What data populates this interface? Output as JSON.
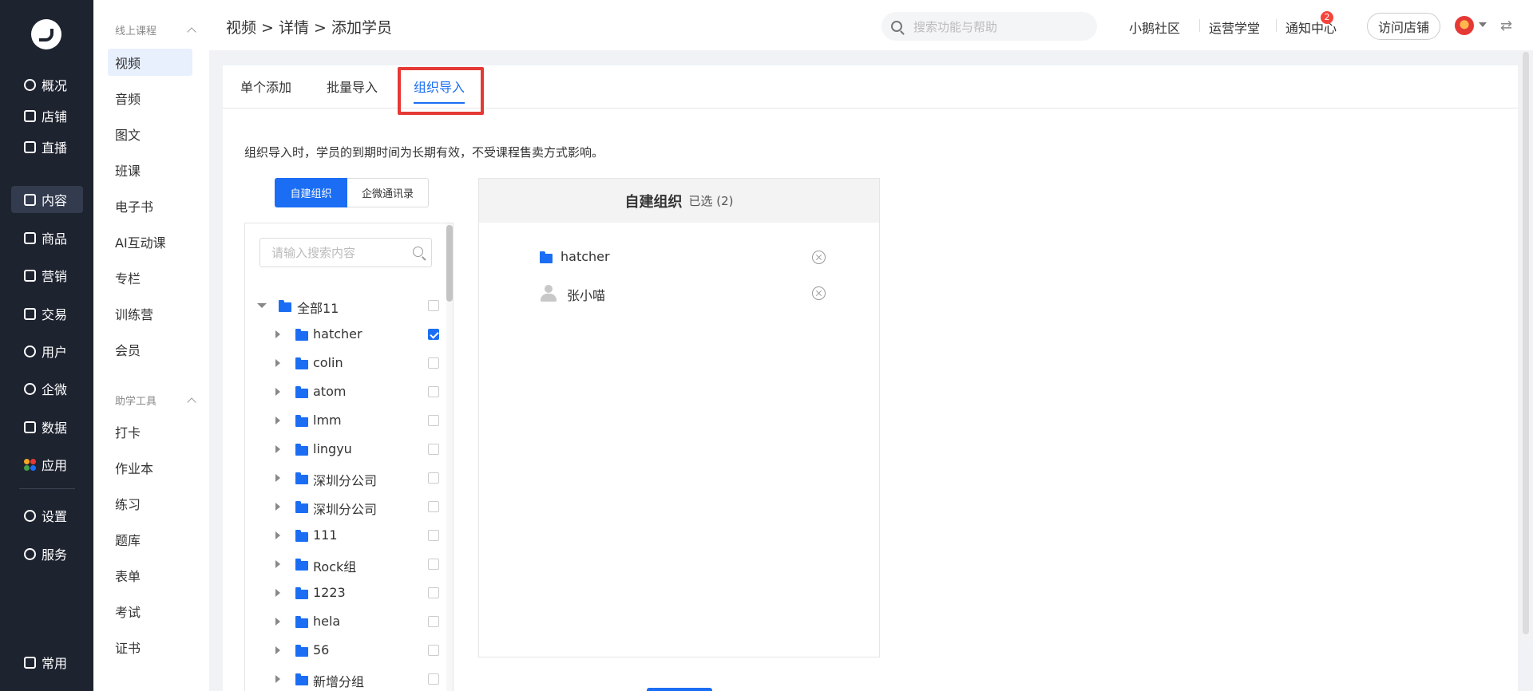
{
  "nav": {
    "items": [
      {
        "label": "概况"
      },
      {
        "label": "店铺"
      },
      {
        "label": "直播"
      },
      {
        "label": "内容"
      },
      {
        "label": "商品"
      },
      {
        "label": "营销"
      },
      {
        "label": "交易"
      },
      {
        "label": "用户"
      },
      {
        "label": "企微"
      },
      {
        "label": "数据"
      },
      {
        "label": "应用"
      },
      {
        "label": "设置"
      },
      {
        "label": "服务"
      },
      {
        "label": "常用"
      }
    ]
  },
  "subnav": {
    "group1": "线上课程",
    "items1": [
      {
        "label": "视频"
      },
      {
        "label": "音频"
      },
      {
        "label": "图文"
      },
      {
        "label": "班课"
      },
      {
        "label": "电子书"
      },
      {
        "label": "AI互动课"
      },
      {
        "label": "专栏"
      },
      {
        "label": "训练营"
      },
      {
        "label": "会员"
      }
    ],
    "group2": "助学工具",
    "items2": [
      {
        "label": "打卡"
      },
      {
        "label": "作业本"
      },
      {
        "label": "练习"
      },
      {
        "label": "题库"
      },
      {
        "label": "表单"
      },
      {
        "label": "考试"
      },
      {
        "label": "证书"
      }
    ]
  },
  "header": {
    "breadcrumb": "视频 > 详情 > 添加学员",
    "search_placeholder": "搜索功能与帮助",
    "links": [
      "小鹅社区",
      "运营学堂",
      "通知中心"
    ],
    "notify_count": "2",
    "visit_label": "访问店铺",
    "swap_icon": "⇄"
  },
  "tabs": [
    {
      "label": "单个添加"
    },
    {
      "label": "批量导入"
    },
    {
      "label": "组织导入"
    }
  ],
  "notice": "组织导入时，学员的到期时间为长期有效，不受课程售卖方式影响。",
  "segment": {
    "on": "自建组织",
    "off": "企微通讯录"
  },
  "tree": {
    "search_placeholder": "请输入搜索内容",
    "root": "全部11",
    "nodes": [
      {
        "label": "hatcher",
        "checked": true
      },
      {
        "label": "colin",
        "checked": false
      },
      {
        "label": "atom",
        "checked": false
      },
      {
        "label": "lmm",
        "checked": false
      },
      {
        "label": "lingyu",
        "checked": false
      },
      {
        "label": "深圳分公司",
        "checked": false
      },
      {
        "label": "深圳分公司",
        "checked": false
      },
      {
        "label": "111",
        "checked": false
      },
      {
        "label": "Rock组",
        "checked": false
      },
      {
        "label": "1223",
        "checked": false
      },
      {
        "label": "hela",
        "checked": false
      },
      {
        "label": "56",
        "checked": false
      },
      {
        "label": "新增分组",
        "checked": false
      }
    ]
  },
  "selected": {
    "title": "自建组织",
    "count": "已选 (2)",
    "items": [
      {
        "label": "hatcher",
        "type": "folder-icon"
      },
      {
        "label": "张小喵",
        "type": "person-icon"
      }
    ]
  },
  "colors": {
    "accent": "#1b6ef3",
    "nav_bg": "#1e2330",
    "highlight": "#e53935"
  }
}
